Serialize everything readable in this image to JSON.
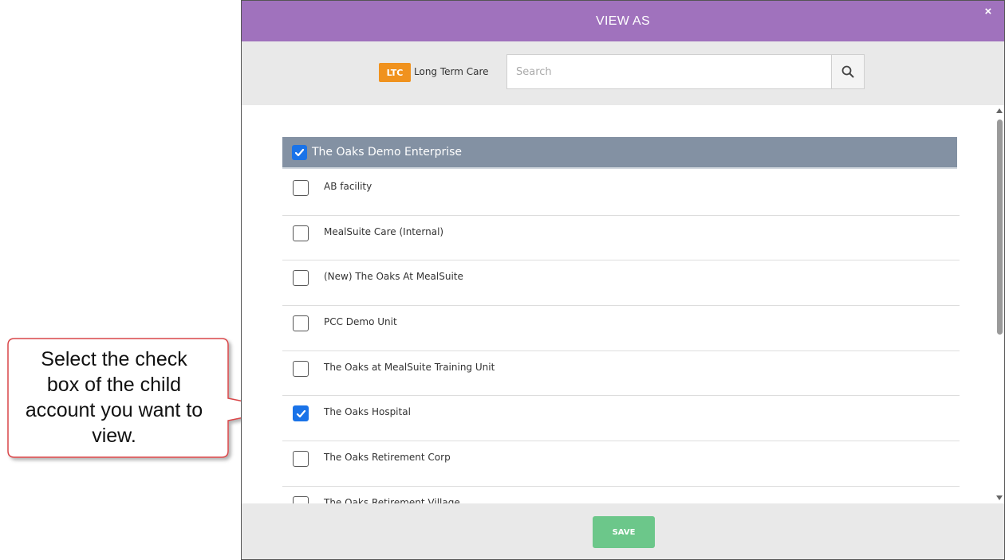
{
  "callout": {
    "text": "Select the check box of the child account you want to view."
  },
  "modal": {
    "title": "VIEW AS",
    "close_label": "×"
  },
  "toolbar": {
    "badge": "LTC",
    "badge_color": "#f0921e",
    "label": "Long Term Care",
    "search_placeholder": "Search",
    "search_value": ""
  },
  "group": {
    "name": "The Oaks Demo Enterprise",
    "checked": true
  },
  "items": [
    {
      "label": "AB facility",
      "checked": false
    },
    {
      "label": "MealSuite Care (Internal)",
      "checked": false
    },
    {
      "label": "(New) The Oaks At MealSuite",
      "checked": false
    },
    {
      "label": "PCC Demo Unit",
      "checked": false
    },
    {
      "label": "The Oaks at MealSuite Training Unit",
      "checked": false
    },
    {
      "label": "The Oaks Hospital",
      "checked": true
    },
    {
      "label": "The Oaks Retirement Corp",
      "checked": false
    },
    {
      "label": "The Oaks Retirement Village",
      "checked": false
    }
  ],
  "footer": {
    "save_label": "SAVE"
  },
  "colors": {
    "header": "#a072bd",
    "group_header": "#8391a3",
    "checkbox_checked": "#1a73e8",
    "save_button": "#6cc78a",
    "callout_border": "#d9474a"
  }
}
